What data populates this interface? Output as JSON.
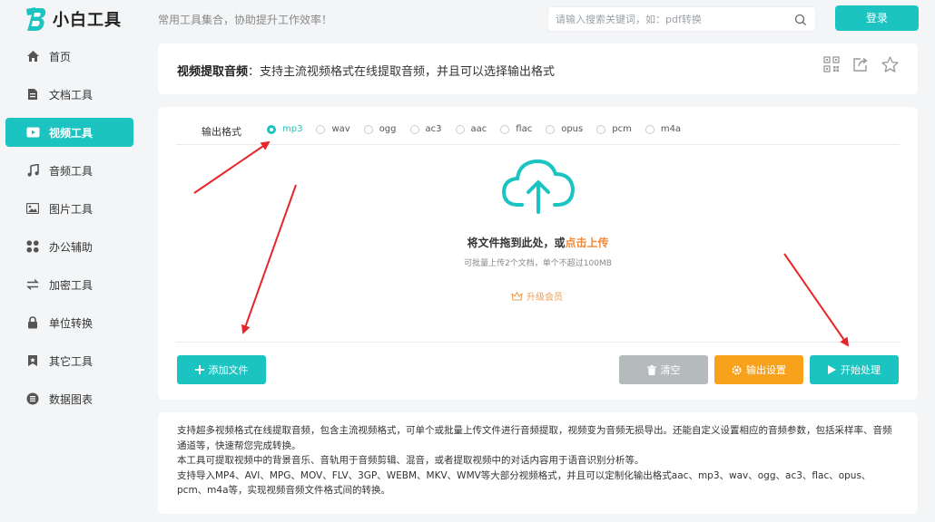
{
  "header": {
    "logo_text": "小白工具",
    "slogan": "常用工具集合，协助提升工作效率！",
    "search_placeholder": "请输入搜索关键词，如：pdf转换",
    "login_label": "登录"
  },
  "sidebar": {
    "items": [
      {
        "label": "首页",
        "icon": "home-icon"
      },
      {
        "label": "文档工具",
        "icon": "document-icon"
      },
      {
        "label": "视频工具",
        "icon": "video-icon",
        "active": true
      },
      {
        "label": "音频工具",
        "icon": "music-icon"
      },
      {
        "label": "图片工具",
        "icon": "image-icon"
      },
      {
        "label": "办公辅助",
        "icon": "office-icon"
      },
      {
        "label": "加密工具",
        "icon": "encrypt-icon"
      },
      {
        "label": "单位转换",
        "icon": "lock-icon"
      },
      {
        "label": "其它工具",
        "icon": "bookmark-icon"
      },
      {
        "label": "数据图表",
        "icon": "chart-icon"
      }
    ]
  },
  "title": {
    "name": "视频提取音频",
    "desc": "：支持主流视频格式在线提取音频，并且可以选择输出格式"
  },
  "converter": {
    "format_label": "输出格式",
    "formats": [
      "mp3",
      "wav",
      "ogg",
      "ac3",
      "aac",
      "flac",
      "opus",
      "pcm",
      "m4a"
    ],
    "selected_format": "mp3",
    "upload_text": "将文件拖到此处，或",
    "upload_link": "点击上传",
    "upload_hint": "可批量上传2个文档，单个不超过100MB",
    "vip_label": "升级会员",
    "add_file_label": "添加文件",
    "clear_label": "清空",
    "settings_label": "输出设置",
    "start_label": "开始处理"
  },
  "description": {
    "paragraphs": [
      "支持超多视频格式在线提取音频，包含主流视频格式，可单个或批量上传文件进行音频提取，视频变为音频无损导出。还能自定义设置相应的音频参数，包括采样率、音频通道等，快速帮您完成转换。",
      "本工具可提取视频中的背景音乐、音轨用于音频剪辑、混音，或者提取视频中的对话内容用于语音识别分析等。",
      "支持导入MP4、AVI、MPG、MOV、FLV、3GP、WEBM、MKV、WMV等大部分视频格式，并且可以定制化输出格式aac、mp3、wav、ogg、ac3、flac、opus、pcm、m4a等，实现视频音频文件格式间的转换。"
    ]
  },
  "colors": {
    "accent": "#1bc4c0",
    "orange": "#f7a21a",
    "gray_button": "#b5bbbd",
    "annotation_red": "#e8262a"
  }
}
